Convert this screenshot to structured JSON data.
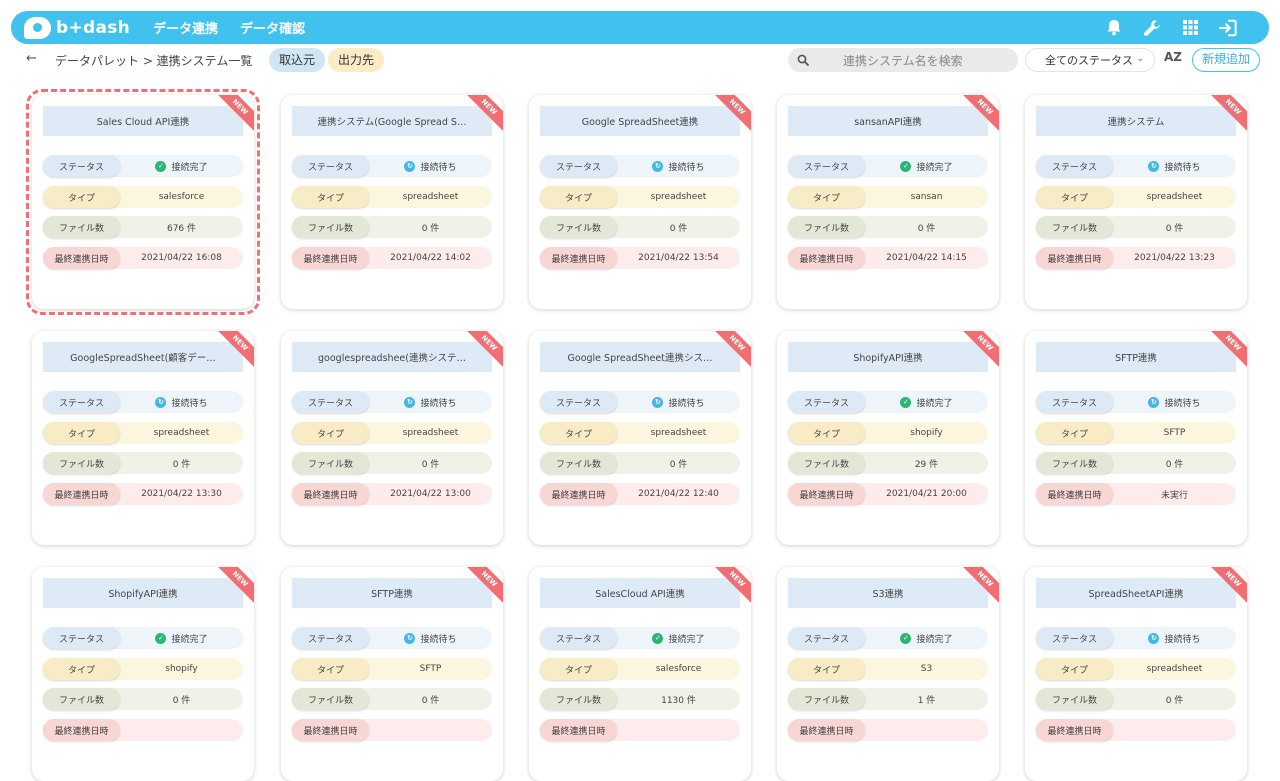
{
  "header": {
    "logo_text": "b+dash",
    "nav": [
      "データ連携",
      "データ確認"
    ],
    "icons": [
      "bell-icon",
      "wrench-icon",
      "grid-icon",
      "logout-icon"
    ]
  },
  "toolbar": {
    "back_glyph": "←",
    "breadcrumb": "データパレット > 連携システム一覧",
    "tab_in": "取込元",
    "tab_out": "出力先",
    "search_placeholder": "連携システム名を検索",
    "status_filter": "全てのステータス",
    "sort_label": "AZ",
    "add_button": "新規追加"
  },
  "labels": {
    "status": "ステータス",
    "type": "タイプ",
    "files": "ファイル数",
    "last_sync": "最終連携日時",
    "badge": "NEW"
  },
  "colors": {
    "brand": "#41c2ee",
    "badge": "#f16e73",
    "connected": "#2bb673",
    "waiting": "#45b6e6",
    "selection_outline": "#f0707a"
  },
  "cards": [
    {
      "title": "Sales Cloud API連携",
      "status": "接続完了",
      "status_kind": "done",
      "type": "salesforce",
      "files": "676 件",
      "last_sync": "2021/04/22 16:08",
      "selected": true
    },
    {
      "title": "連携システム(Google Spread S…",
      "status": "接続待ち",
      "status_kind": "wait",
      "type": "spreadsheet",
      "files": "0 件",
      "last_sync": "2021/04/22 14:02"
    },
    {
      "title": "Google SpreadSheet連携",
      "status": "接続待ち",
      "status_kind": "wait",
      "type": "spreadsheet",
      "files": "0 件",
      "last_sync": "2021/04/22 13:54"
    },
    {
      "title": "sansanAPI連携",
      "status": "接続完了",
      "status_kind": "done",
      "type": "sansan",
      "files": "0 件",
      "last_sync": "2021/04/22 14:15"
    },
    {
      "title": "連携システム",
      "status": "接続待ち",
      "status_kind": "wait",
      "type": "spreadsheet",
      "files": "0 件",
      "last_sync": "2021/04/22 13:23"
    },
    {
      "title": "GoogleSpreadSheet(顧客デー…",
      "status": "接続待ち",
      "status_kind": "wait",
      "type": "spreadsheet",
      "files": "0 件",
      "last_sync": "2021/04/22 13:30"
    },
    {
      "title": "googlespreadshee(連携システ…",
      "status": "接続待ち",
      "status_kind": "wait",
      "type": "spreadsheet",
      "files": "0 件",
      "last_sync": "2021/04/22 13:00"
    },
    {
      "title": "Google SpreadSheet連携シス…",
      "status": "接続待ち",
      "status_kind": "wait",
      "type": "spreadsheet",
      "files": "0 件",
      "last_sync": "2021/04/22 12:40"
    },
    {
      "title": "ShopifyAPI連携",
      "status": "接続完了",
      "status_kind": "done",
      "type": "shopify",
      "files": "29 件",
      "last_sync": "2021/04/21 20:00"
    },
    {
      "title": "SFTP連携",
      "status": "接続待ち",
      "status_kind": "wait",
      "type": "SFTP",
      "files": "0 件",
      "last_sync": "未実行"
    },
    {
      "title": "ShopifyAPI連携",
      "status": "接続完了",
      "status_kind": "done",
      "type": "shopify",
      "files": "0 件",
      "last_sync": ""
    },
    {
      "title": "SFTP連携",
      "status": "接続待ち",
      "status_kind": "wait",
      "type": "SFTP",
      "files": "0 件",
      "last_sync": ""
    },
    {
      "title": "SalesCloud API連携",
      "status": "接続完了",
      "status_kind": "done",
      "type": "salesforce",
      "files": "1130 件",
      "last_sync": ""
    },
    {
      "title": "S3連携",
      "status": "接続完了",
      "status_kind": "done",
      "type": "S3",
      "files": "1 件",
      "last_sync": ""
    },
    {
      "title": "SpreadSheetAPI連携",
      "status": "接続待ち",
      "status_kind": "wait",
      "type": "spreadsheet",
      "files": "0 件",
      "last_sync": ""
    }
  ]
}
